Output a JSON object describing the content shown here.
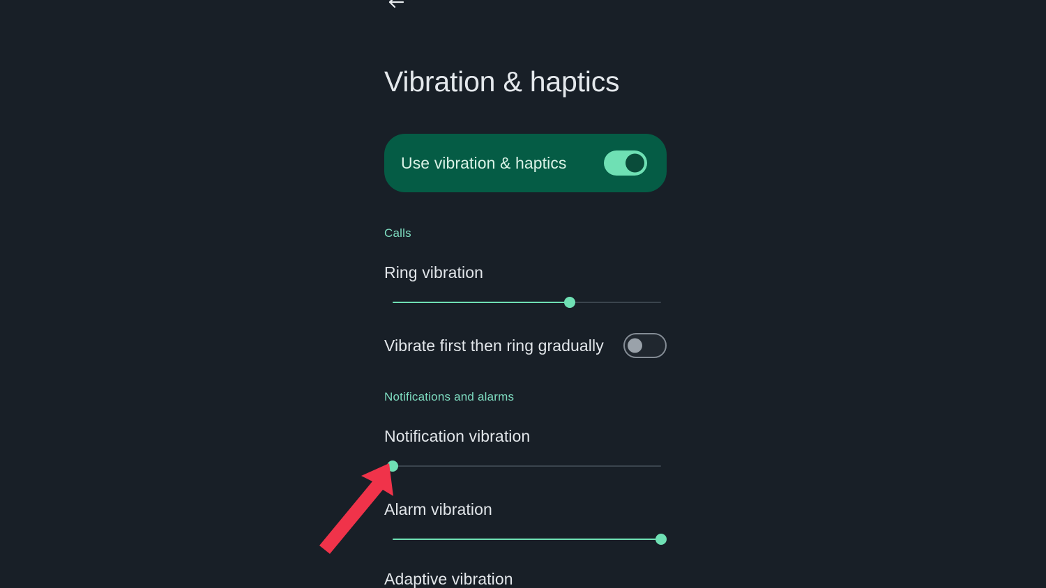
{
  "app": {
    "screen_title": "Vibration & haptics",
    "background_color": "#181f27",
    "accent_color": "#6fe0b4",
    "section_header_color": "#7edcc0",
    "card_color": "#055c45"
  },
  "navigation": {
    "back_icon": "arrow-left-icon"
  },
  "master_toggle": {
    "label": "Use vibration & haptics",
    "state": "on"
  },
  "sections": [
    {
      "header": "Calls",
      "rows": [
        {
          "type": "slider",
          "label": "Ring vibration",
          "value": 66,
          "min": 0,
          "max": 100
        },
        {
          "type": "toggle",
          "label": "Vibrate first then ring gradually",
          "state": "off"
        }
      ]
    },
    {
      "header": "Notifications and alarms",
      "rows": [
        {
          "type": "slider",
          "label": "Notification vibration",
          "value": 0,
          "min": 0,
          "max": 100
        },
        {
          "type": "slider",
          "label": "Alarm vibration",
          "value": 100,
          "min": 0,
          "max": 100
        },
        {
          "type": "label_only",
          "label": "Adaptive vibration"
        }
      ]
    }
  ],
  "annotation": {
    "type": "arrow",
    "color": "#f0334a",
    "points_to": "notification-vibration-slider-thumb"
  }
}
